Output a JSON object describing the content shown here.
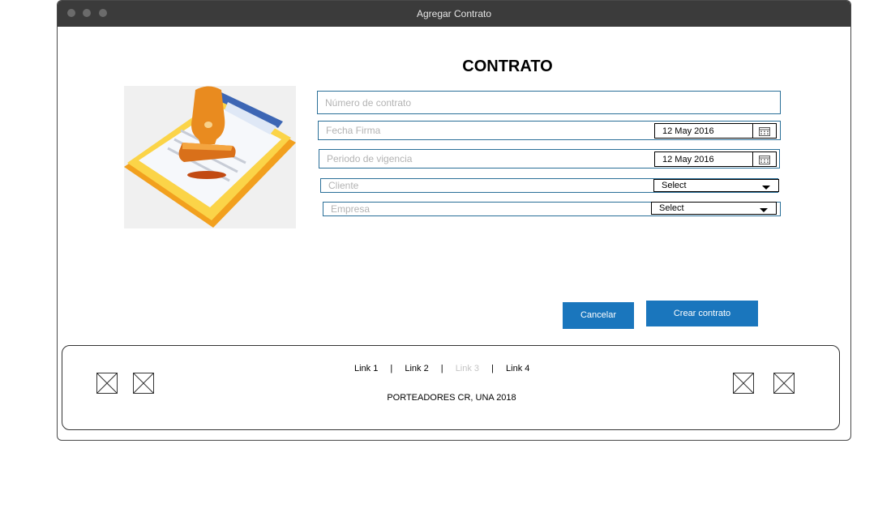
{
  "window": {
    "title": "Agregar Contrato"
  },
  "form": {
    "heading": "CONTRATO",
    "numero_placeholder": "Número de contrato",
    "fecha_firma_placeholder": "Fecha Firma",
    "fecha_firma_value": "12 May 2016",
    "periodo_placeholder": "Periodo de vigencia",
    "periodo_value": "12 May 2016",
    "cliente_placeholder": "Cliente",
    "cliente_value": "Select",
    "empresa_placeholder": "Empresa",
    "empresa_value": "Select"
  },
  "actions": {
    "cancel_label": "Cancelar",
    "create_label": "Crear contrato"
  },
  "footer": {
    "links": [
      "Link 1",
      "Link 2",
      "Link 3",
      "Link 4"
    ],
    "separator": "|",
    "copyright": "PORTEADORES CR, UNA 2018"
  },
  "colors": {
    "titlebar": "#3b3b3b",
    "accent": "#1a76bd",
    "field_border": "#2a6f98",
    "placeholder": "#b3b3b3",
    "disabled_link": "#c4c4c4"
  }
}
